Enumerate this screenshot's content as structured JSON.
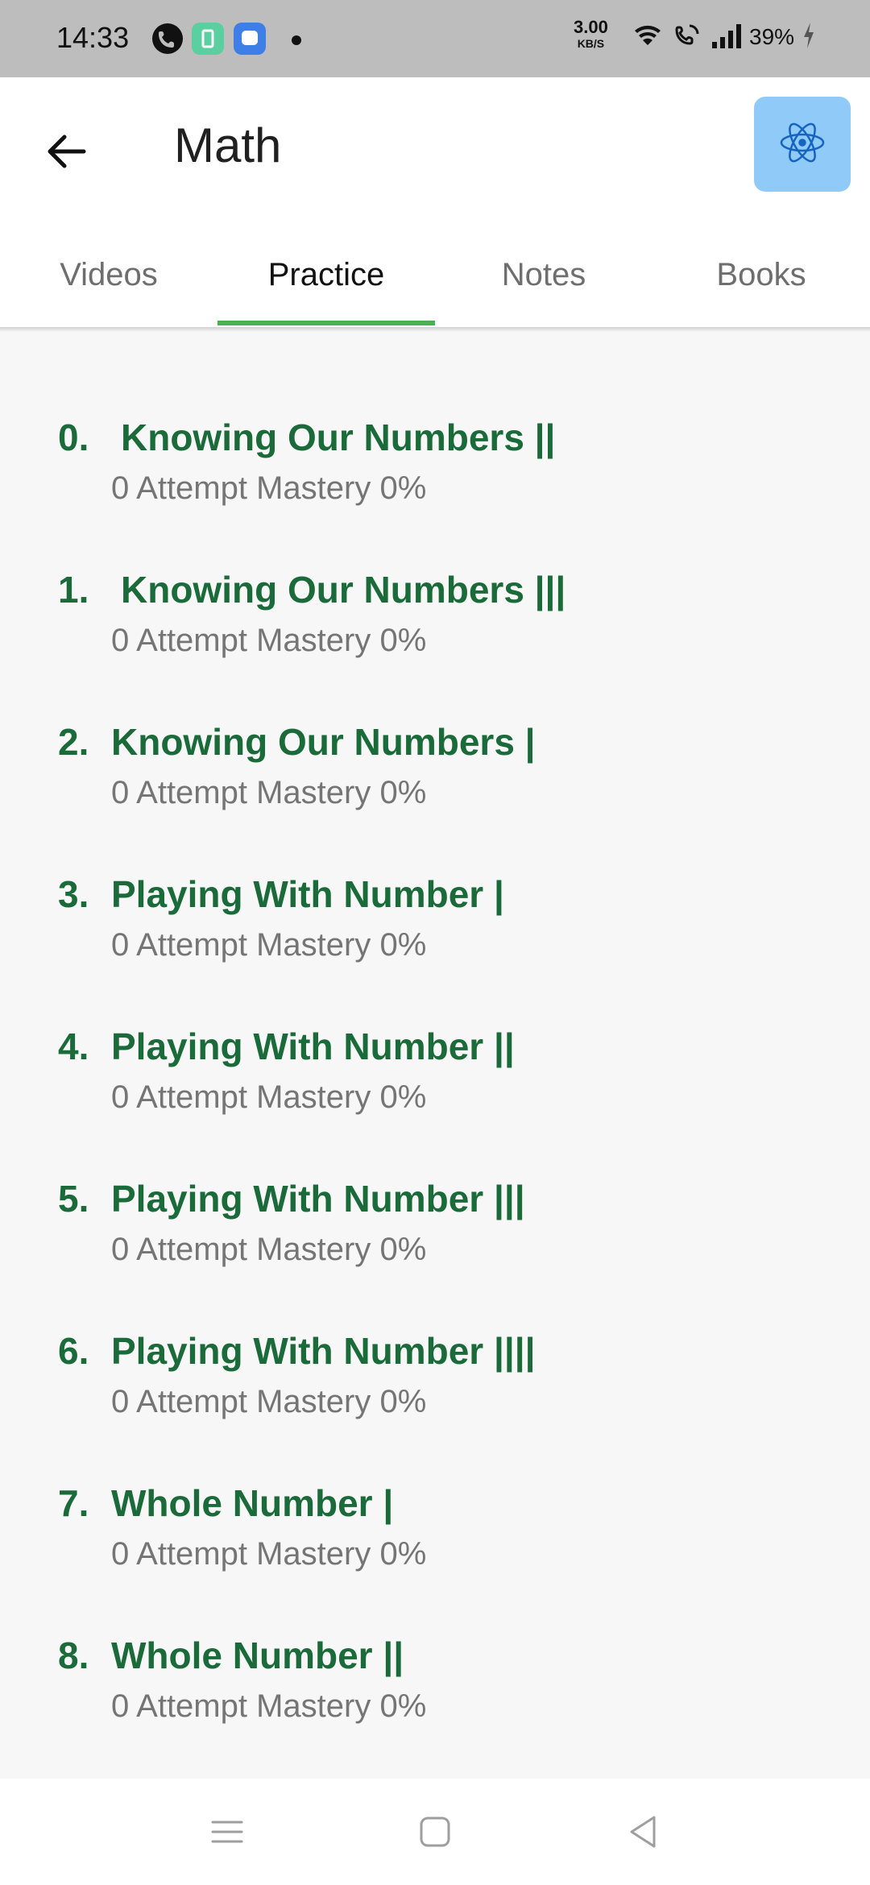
{
  "status_bar": {
    "time": "14:33",
    "icons": [
      "phone-icon",
      "app-icon",
      "chat-icon"
    ],
    "net_speed": "3.00",
    "net_speed_unit": "KB/S",
    "battery": "39%"
  },
  "header": {
    "title": "Math",
    "back_icon": "arrow-left-icon",
    "action_icon": "atom-icon"
  },
  "tabs": [
    {
      "label": "Videos",
      "active": false
    },
    {
      "label": "Practice",
      "active": true
    },
    {
      "label": "Notes",
      "active": false
    },
    {
      "label": "Books",
      "active": false
    }
  ],
  "colors": {
    "accent": "#4caf50",
    "item_title": "#1b6b3a",
    "action_button": "#90caf9"
  },
  "practice_items": [
    {
      "num": "0.",
      "title": "Knowing Our Numbers ||",
      "subtitle": "0 Attempt Mastery 0%"
    },
    {
      "num": "1.",
      "title": "Knowing Our Numbers |||",
      "subtitle": "0 Attempt Mastery 0%"
    },
    {
      "num": "2.",
      "title": "Knowing Our Numbers |",
      "subtitle": "0 Attempt Mastery 0%"
    },
    {
      "num": "3.",
      "title": "Playing With Number |",
      "subtitle": "0 Attempt Mastery 0%"
    },
    {
      "num": "4.",
      "title": "Playing With Number ||",
      "subtitle": "0 Attempt Mastery 0%"
    },
    {
      "num": "5.",
      "title": "Playing With Number |||",
      "subtitle": "0 Attempt Mastery 0%"
    },
    {
      "num": "6.",
      "title": "Playing With Number ||||",
      "subtitle": "0 Attempt Mastery 0%"
    },
    {
      "num": "7.",
      "title": "Whole Number |",
      "subtitle": "0 Attempt Mastery 0%"
    },
    {
      "num": "8.",
      "title": "Whole Number ||",
      "subtitle": "0 Attempt Mastery 0%"
    }
  ],
  "nav_bar": [
    "menu-icon",
    "home-icon",
    "back-triangle-icon"
  ]
}
